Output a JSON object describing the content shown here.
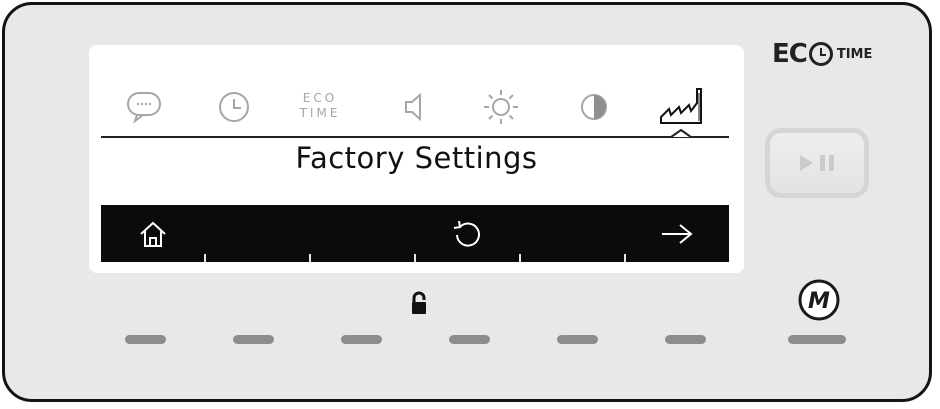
{
  "brand": {
    "eco": "EC",
    "time": "TIME"
  },
  "screen": {
    "title": "Factory Settings",
    "menu_icons": [
      "chat-bubble-icon",
      "clock-icon",
      "eco-time-icon",
      "speaker-icon",
      "brightness-icon",
      "contrast-icon",
      "factory-icon"
    ],
    "eco_time_label_line1": "ECO",
    "eco_time_label_line2": "TIME",
    "selected_menu": "factory-icon",
    "function_bar": [
      "home-icon",
      "reset-icon",
      "arrow-right-icon"
    ]
  },
  "colors": {
    "panel_bg": "#e7e8e9",
    "panel_border": "#141414",
    "screen_bg": "#ffffff",
    "func_bar_bg": "#0b0b0b",
    "led": "#8c8d8e",
    "inactive_icon": "#a6a6a6"
  },
  "leds": {
    "count": 7
  },
  "buttons": {
    "play_pause": "play-pause-icon",
    "mode": "M"
  },
  "lock": "lock-icon"
}
